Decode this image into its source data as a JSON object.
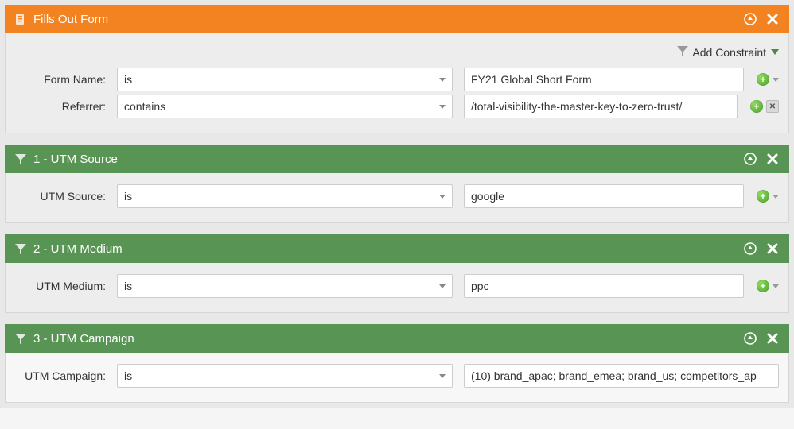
{
  "constraint_bar": {
    "label": "Add Constraint"
  },
  "panels": [
    {
      "title": "Fills Out Form",
      "color": "orange",
      "icon": "form",
      "show_constraint_bar": true,
      "rows": [
        {
          "label": "Form Name:",
          "operator": "is",
          "value": "FY21 Global Short Form",
          "trail": "plus"
        },
        {
          "label": "Referrer:",
          "operator": "contains",
          "value": "/total-visibility-the-master-key-to-zero-trust/",
          "trail": "plus_del"
        }
      ]
    },
    {
      "title": "1 - UTM Source",
      "color": "green",
      "icon": "filter",
      "rows": [
        {
          "label": "UTM Source:",
          "operator": "is",
          "value": "google",
          "trail": "plus"
        }
      ]
    },
    {
      "title": "2 - UTM Medium",
      "color": "green",
      "icon": "filter",
      "rows": [
        {
          "label": "UTM Medium:",
          "operator": "is",
          "value": "ppc",
          "trail": "plus"
        }
      ]
    },
    {
      "title": "3 - UTM Campaign",
      "color": "green",
      "icon": "filter",
      "body_light": true,
      "rows": [
        {
          "label": "UTM Campaign:",
          "operator": "is",
          "value": "(10) brand_apac; brand_emea; brand_us; competitors_ap",
          "trail": "none"
        }
      ]
    }
  ]
}
